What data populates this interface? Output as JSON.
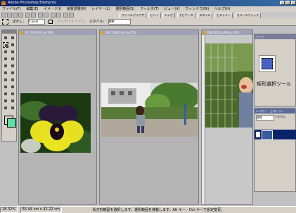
{
  "window": {
    "title": "Adobe Photoshop Elements"
  },
  "menu": [
    "ファイル(F)",
    "編集(E)",
    "イメージ(I)",
    "画質調整(N)",
    "レイヤー(L)",
    "選択範囲(S)",
    "フィルタ(T)",
    "ビュー(V)",
    "ウィンドウ(W)",
    "ヘルプ(H)"
  ],
  "shortcuts": [
    "ファイルブラウザ",
    "ヒント",
    "レシピ",
    "ナビゲータ",
    "スタイル",
    "ヒストリー",
    "カラースウォッチ"
  ],
  "options": {
    "feather_label": "ぼかし:",
    "feather_value": "0 pixel",
    "antialias_label": "アンチエイリアス",
    "style_label": "スタイル:",
    "style_value": "標準"
  },
  "docs": [
    {
      "title": "1C_0016.JPG @ 33%"
    },
    {
      "title": "DSC_0081.JPG @ 25%"
    },
    {
      "title": "DSC00153.JPG @ 25%"
    }
  ],
  "hint_palette": {
    "title": "ヒント",
    "tool_name": "矩形選択ツール"
  },
  "layers_palette": {
    "tabs": [
      "レイヤー",
      "ヒストリー"
    ],
    "mode": "通常",
    "opacity_label": "不透明度"
  },
  "status": {
    "zoom": "18.32%",
    "size": "56.44 cm x 42.22 cm",
    "hint": "長方形範囲を選択します。選択範囲を移動します。Alt キー、Ctrl キーで設定変更。"
  },
  "colors": {
    "foreground": "#ffffff",
    "background": "#5ce0a4"
  }
}
